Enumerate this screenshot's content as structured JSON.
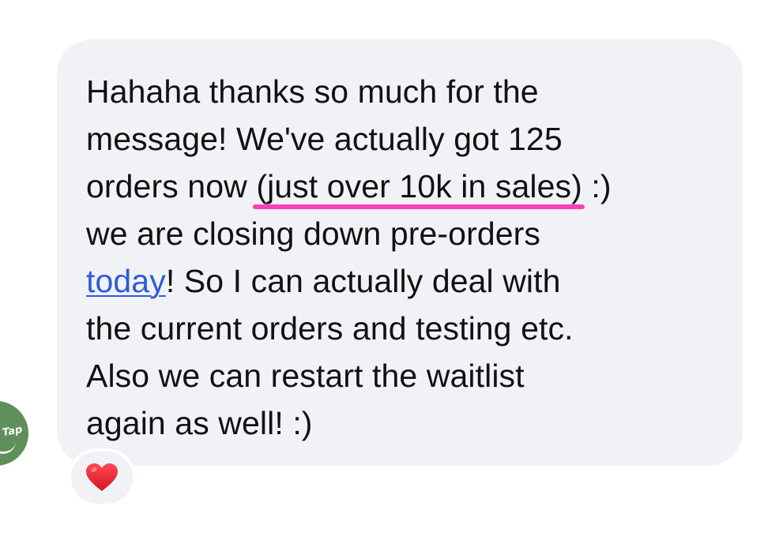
{
  "message": {
    "lines": [
      "Hahaha thanks so much for the",
      "message! We've actually got 125",
      "orders now ",
      "(just over 10k in sales)",
      " :)",
      "we are closing down pre-orders",
      "today",
      "! So I can actually deal with",
      "the current orders and testing etc.",
      "Also we can restart the waitlist",
      "again as well! :)"
    ]
  },
  "reaction": {
    "emoji": "❤️",
    "icon": "red-heart-icon"
  },
  "tap_badge": {
    "label": "Tap",
    "icon": "tap-logo-icon"
  },
  "colors": {
    "bubble": "#f1f2f6",
    "text": "#111111",
    "link": "#2f5bd8",
    "annotation_underline": "#ff3fb6",
    "heart": "#e0212d",
    "tap_badge": "#5f8f5b"
  }
}
